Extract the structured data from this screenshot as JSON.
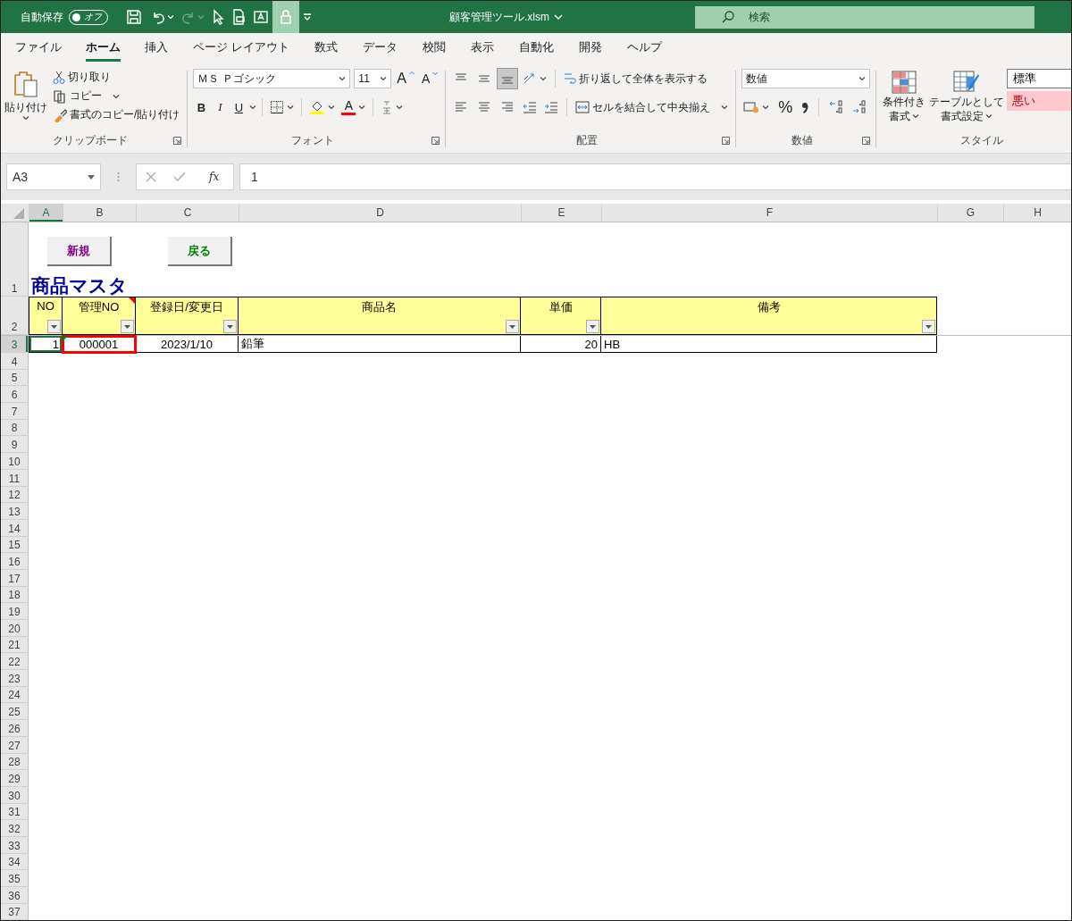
{
  "titlebar": {
    "autosave_label": "自動保存",
    "autosave_state": "オフ",
    "autosave_on": false,
    "redo_enabled": false,
    "lock_active": true,
    "filename": "顧客管理ツール.xlsm",
    "search": {
      "placeholder": "検索"
    }
  },
  "tabs": [
    {
      "label": "ファイル",
      "selected": false
    },
    {
      "label": "ホーム",
      "selected": true
    },
    {
      "label": "挿入",
      "selected": false
    },
    {
      "label": "ページ レイアウト",
      "selected": false
    },
    {
      "label": "数式",
      "selected": false
    },
    {
      "label": "データ",
      "selected": false
    },
    {
      "label": "校閲",
      "selected": false
    },
    {
      "label": "表示",
      "selected": false
    },
    {
      "label": "自動化",
      "selected": false
    },
    {
      "label": "開発",
      "selected": false
    },
    {
      "label": "ヘルプ",
      "selected": false
    }
  ],
  "ribbon": {
    "clipboard": {
      "paste": "貼り付け",
      "cut": "切り取り",
      "copy": "コピー",
      "format_painter": "書式のコピー/貼り付け",
      "label": "クリップボード"
    },
    "font": {
      "name": "ＭＳ Ｐゴシック",
      "size": "11",
      "grow": "A",
      "shrink": "A",
      "bold": "B",
      "italic": "I",
      "underline": "U",
      "font_color": "A",
      "label": "フォント"
    },
    "alignment": {
      "align_top": false,
      "align_middle": false,
      "align_bottom": true,
      "wrap_text": "折り返して全体を表示する",
      "merge": "セルを結合して中央揃え",
      "label": "配置"
    },
    "number": {
      "format": "数値",
      "percent": "%",
      "label": "数値"
    },
    "styles": {
      "conditional_formatting": [
        "条件付き",
        "書式"
      ],
      "format_as_table": [
        "テーブルとして",
        "書式設定"
      ],
      "gallery": [
        {
          "label": "標準",
          "kind": "normal"
        },
        {
          "label": "悪い",
          "kind": "bad"
        }
      ],
      "label": "スタイル"
    }
  },
  "formula_bar": {
    "name_box": "A3",
    "function_label": "fx",
    "formula": "1"
  },
  "sheet": {
    "columns": [
      {
        "label": "A",
        "selected": true
      },
      {
        "label": "B",
        "selected": false
      },
      {
        "label": "C",
        "selected": false
      },
      {
        "label": "D",
        "selected": false
      },
      {
        "label": "E",
        "selected": false
      },
      {
        "label": "F",
        "selected": false
      },
      {
        "label": "G",
        "selected": false
      },
      {
        "label": "H",
        "selected": false
      }
    ],
    "rows": [
      {
        "label": "1",
        "selected": false
      },
      {
        "label": "2",
        "selected": false
      },
      {
        "label": "3",
        "selected": true
      },
      {
        "label": "4",
        "selected": false
      },
      {
        "label": "5",
        "selected": false
      },
      {
        "label": "6",
        "selected": false
      },
      {
        "label": "7",
        "selected": false
      },
      {
        "label": "8",
        "selected": false
      },
      {
        "label": "9",
        "selected": false
      },
      {
        "label": "10",
        "selected": false
      },
      {
        "label": "11",
        "selected": false
      },
      {
        "label": "12",
        "selected": false
      },
      {
        "label": "13",
        "selected": false
      },
      {
        "label": "14",
        "selected": false
      },
      {
        "label": "15",
        "selected": false
      },
      {
        "label": "16",
        "selected": false
      },
      {
        "label": "17",
        "selected": false
      },
      {
        "label": "18",
        "selected": false
      },
      {
        "label": "19",
        "selected": false
      },
      {
        "label": "20",
        "selected": false
      },
      {
        "label": "21",
        "selected": false
      },
      {
        "label": "22",
        "selected": false
      },
      {
        "label": "23",
        "selected": false
      },
      {
        "label": "24",
        "selected": false
      },
      {
        "label": "25",
        "selected": false
      },
      {
        "label": "26",
        "selected": false
      },
      {
        "label": "27",
        "selected": false
      },
      {
        "label": "28",
        "selected": false
      },
      {
        "label": "29",
        "selected": false
      },
      {
        "label": "30",
        "selected": false
      },
      {
        "label": "31",
        "selected": false
      },
      {
        "label": "32",
        "selected": false
      },
      {
        "label": "33",
        "selected": false
      },
      {
        "label": "34",
        "selected": false
      },
      {
        "label": "35",
        "selected": false
      },
      {
        "label": "36",
        "selected": false
      },
      {
        "label": "37",
        "selected": false
      }
    ],
    "buttons": [
      {
        "label": "新規",
        "color": "#800080"
      },
      {
        "label": "戻る",
        "color": "#008000"
      }
    ],
    "title": "商品マスタ",
    "table": {
      "columns": [
        {
          "label": "NO",
          "comment": false
        },
        {
          "label": "管理NO",
          "comment": true
        },
        {
          "label": "登録日/変更日",
          "comment": false
        },
        {
          "label": "商品名",
          "comment": false
        },
        {
          "label": "単価",
          "comment": false
        },
        {
          "label": "備考",
          "comment": false
        }
      ],
      "rows": [
        {
          "cells": [
            {
              "value": "1",
              "selected": true,
              "highlighted": false,
              "error_flag": false
            },
            {
              "value": "000001",
              "selected": false,
              "highlighted": true,
              "error_flag": true
            },
            {
              "value": "2023/1/10",
              "selected": false,
              "highlighted": false,
              "error_flag": false
            },
            {
              "value": "鉛筆",
              "selected": false,
              "highlighted": false,
              "error_flag": false
            },
            {
              "value": "20",
              "selected": false,
              "highlighted": false,
              "error_flag": false
            },
            {
              "value": "HB",
              "selected": false,
              "highlighted": false,
              "error_flag": false
            }
          ]
        }
      ]
    }
  }
}
